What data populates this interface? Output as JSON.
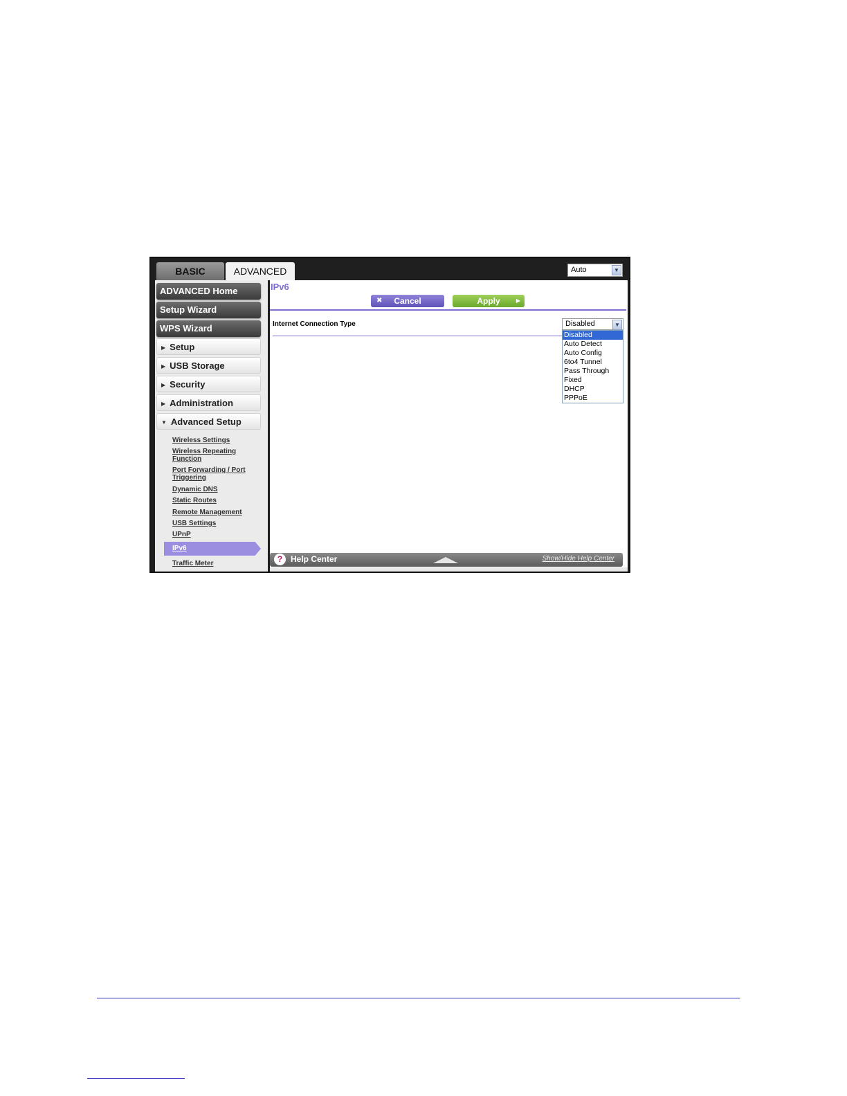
{
  "tabs": {
    "basic": "BASIC",
    "advanced": "ADVANCED"
  },
  "language_select": {
    "value": "Auto"
  },
  "sidebar": {
    "primary": [
      "ADVANCED Home",
      "Setup Wizard",
      "WPS Wizard"
    ],
    "sections": [
      "Setup",
      "USB Storage",
      "Security",
      "Administration",
      "Advanced Setup"
    ],
    "advanced_setup_items": [
      "Wireless Settings",
      "Wireless Repeating Function",
      "Port Forwarding / Port Triggering",
      "Dynamic DNS",
      "Static Routes",
      "Remote Management",
      "USB Settings",
      "UPnP",
      "IPv6",
      "Traffic Meter"
    ]
  },
  "main": {
    "title": "IPv6",
    "cancel_label": "Cancel",
    "apply_label": "Apply",
    "connection_type_label": "Internet Connection Type",
    "connection_type_value": "Disabled",
    "connection_type_options": [
      "Disabled",
      "Auto Detect",
      "Auto Config",
      "6to4 Tunnel",
      "Pass Through",
      "Fixed",
      "DHCP",
      "PPPoE"
    ]
  },
  "help": {
    "label": "Help Center",
    "toggle": "Show/Hide Help Center",
    "icon": "?"
  },
  "colors": {
    "accent_purple": "#7c6ed2",
    "apply_green": "#7ab83a",
    "dropdown_highlight": "#3168d5"
  }
}
